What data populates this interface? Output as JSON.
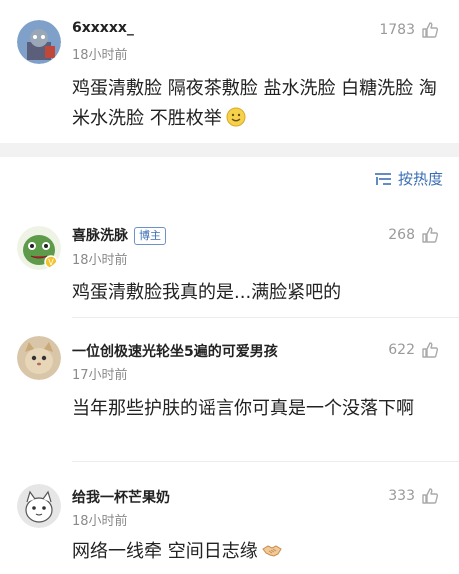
{
  "sort": {
    "label": "按热度",
    "icon": "sort-lines-icon"
  },
  "comments": [
    {
      "username": "6xxxxx_",
      "time": "18小时前",
      "likes": "1783",
      "text": "鸡蛋清敷脸 隔夜茶敷脸 盐水洗脸 白糖洗脸 淘米水洗脸 不胜枚举",
      "emoji": "smile-emoji"
    },
    {
      "username": "喜脉洗脉",
      "badge": "博主",
      "time": "18小时前",
      "likes": "268",
      "text": "鸡蛋清敷脸我真的是...满脸紧吧的"
    },
    {
      "username": "一位创极速光轮坐5遍的可爱男孩",
      "time": "17小时前",
      "likes": "622",
      "text": "当年那些护肤的谣言你可真是一个没落下啊"
    },
    {
      "username": "给我一杯芒果奶",
      "time": "18小时前",
      "likes": "333",
      "text": "网络一线牵  空间日志缘",
      "emoji": "handshake-emoji"
    }
  ],
  "colors": {
    "link": "#3a6fb4",
    "meta": "#8a8a8a",
    "band": "#f2f2f2"
  }
}
